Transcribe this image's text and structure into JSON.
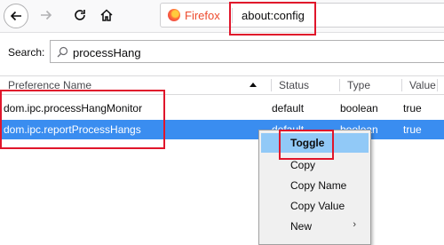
{
  "toolbar": {
    "browser_label": "Firefox",
    "url": "about:config"
  },
  "search": {
    "label": "Search:",
    "value": "processHang"
  },
  "table": {
    "headers": [
      "Preference Name",
      "Status",
      "Type",
      "Value"
    ],
    "rows": [
      {
        "name": "dom.ipc.processHangMonitor",
        "status": "default",
        "type": "boolean",
        "value": "true"
      },
      {
        "name": "dom.ipc.reportProcessHangs",
        "status": "default",
        "type": "boolean",
        "value": "true"
      }
    ]
  },
  "context_menu": {
    "items": [
      "Toggle",
      "Copy",
      "Copy Name",
      "Copy Value",
      "New"
    ]
  },
  "colors": {
    "selection": "#3a8df0",
    "highlight_box": "#e0162b",
    "menu_hover": "#91c9f7"
  },
  "icons": [
    "back-arrow-icon",
    "forward-arrow-icon",
    "reload-icon",
    "home-icon",
    "firefox-logo-icon",
    "search-icon",
    "sort-ascending-icon",
    "submenu-arrow-icon"
  ]
}
